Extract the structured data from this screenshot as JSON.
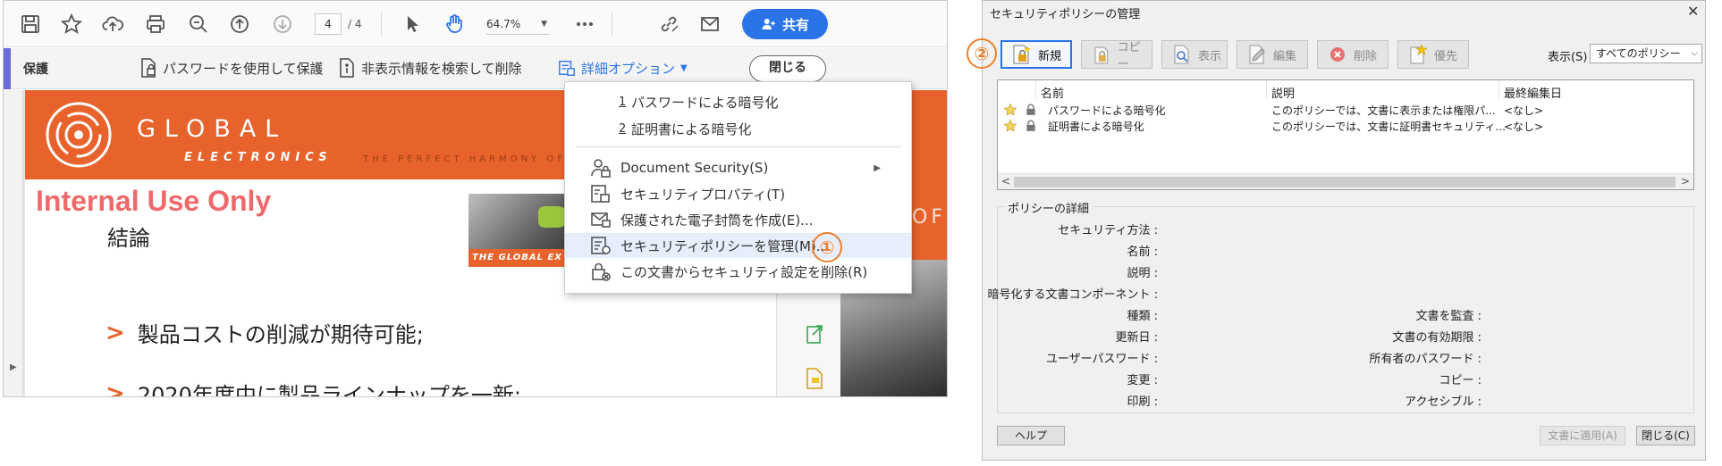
{
  "acrobat": {
    "toolbar": {
      "page_current": "4",
      "page_total": "/  4",
      "zoom": "64.7%",
      "share_label": "共有"
    },
    "secbar": {
      "title": "保護",
      "protect_password": "パスワードを使用して保護",
      "find_remove": "非表示情報を検索して削除",
      "advanced": "詳細オプション",
      "close": "閉じる"
    },
    "document": {
      "logo_name": "GLOBAL",
      "logo_sub": "ELECTRONICS",
      "tagline": "THE PERFECT HARMONY OF",
      "internal": "Internal Use Only",
      "conclusion": "結論",
      "bullets": [
        "製品コストの削減が期待可能;",
        "2020年度中に製品ラインナップを一新;"
      ],
      "photo_strip": "THE GLOBAL EX",
      "edge_text": "OF"
    },
    "menu": {
      "items": [
        {
          "num": "1",
          "label": "パスワードによる暗号化"
        },
        {
          "num": "2",
          "label": "証明書による暗号化"
        },
        {
          "label": "Document Security(S)"
        },
        {
          "label": "セキュリティプロパティ(T)"
        },
        {
          "label": "保護された電子封筒を作成(E)..."
        },
        {
          "label": "セキュリティポリシーを管理(M)..."
        },
        {
          "label": "この文書からセキュリティ設定を削除(R)"
        }
      ],
      "callout": "①"
    }
  },
  "dialog": {
    "title": "セキュリティポリシーの管理",
    "close_x": "✕",
    "callout": "②",
    "buttons": {
      "new": "新規",
      "copy": "コピー",
      "view": "表示",
      "edit": "編集",
      "delete": "削除",
      "favorite": "優先"
    },
    "show_label": "表示(S)",
    "show_value": "すべてのポリシー",
    "columns": [
      "名前",
      "説明",
      "最終編集日"
    ],
    "rows": [
      {
        "name": "パスワードによる暗号化",
        "desc": "このポリシーでは、文書に表示または権限パ...",
        "date": "<なし>"
      },
      {
        "name": "証明書による暗号化",
        "desc": "このポリシーでは、文書に証明書セキュリティ...",
        "date": "<なし>"
      }
    ],
    "details_title": "ポリシーの詳細",
    "details_left": [
      "セキュリティ方法 :",
      "名前 :",
      "説明 :",
      "暗号化する文書コンポーネント :",
      "種類 :",
      "更新日 :",
      "ユーザーパスワード :",
      "変更 :",
      "印刷 :"
    ],
    "details_right": [
      "文書を監査 :",
      "文書の有効期限 :",
      "所有者のパスワード :",
      "コピー :",
      "アクセシブル :"
    ],
    "help": "ヘルプ",
    "apply": "文書に適用(A)",
    "close": "閉じる(C)"
  },
  "colors": {
    "accent_blue": "#2b74e8",
    "brand_orange": "#e8632b",
    "callout_orange": "#f07f2c",
    "security_bar": "#6c6cd9"
  }
}
